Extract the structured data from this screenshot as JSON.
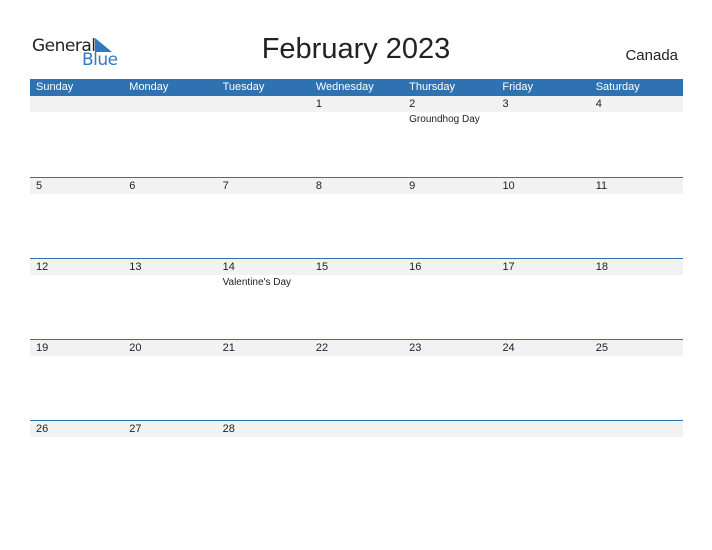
{
  "logo": {
    "line1": "General",
    "line2": "Blue"
  },
  "title": "February 2023",
  "country": "Canada",
  "colors": {
    "accent": "#2f72b2",
    "strip": "#f2f2f2"
  },
  "weekdays": [
    "Sunday",
    "Monday",
    "Tuesday",
    "Wednesday",
    "Thursday",
    "Friday",
    "Saturday"
  ],
  "weeks": [
    [
      {
        "day": ""
      },
      {
        "day": ""
      },
      {
        "day": ""
      },
      {
        "day": "1"
      },
      {
        "day": "2",
        "event": "Groundhog Day"
      },
      {
        "day": "3"
      },
      {
        "day": "4"
      }
    ],
    [
      {
        "day": "5"
      },
      {
        "day": "6"
      },
      {
        "day": "7"
      },
      {
        "day": "8"
      },
      {
        "day": "9"
      },
      {
        "day": "10"
      },
      {
        "day": "11"
      }
    ],
    [
      {
        "day": "12"
      },
      {
        "day": "13"
      },
      {
        "day": "14",
        "event": "Valentine's Day"
      },
      {
        "day": "15"
      },
      {
        "day": "16"
      },
      {
        "day": "17"
      },
      {
        "day": "18"
      }
    ],
    [
      {
        "day": "19"
      },
      {
        "day": "20"
      },
      {
        "day": "21"
      },
      {
        "day": "22"
      },
      {
        "day": "23"
      },
      {
        "day": "24"
      },
      {
        "day": "25"
      }
    ],
    [
      {
        "day": "26"
      },
      {
        "day": "27"
      },
      {
        "day": "28"
      },
      {
        "day": ""
      },
      {
        "day": ""
      },
      {
        "day": ""
      },
      {
        "day": ""
      }
    ]
  ]
}
